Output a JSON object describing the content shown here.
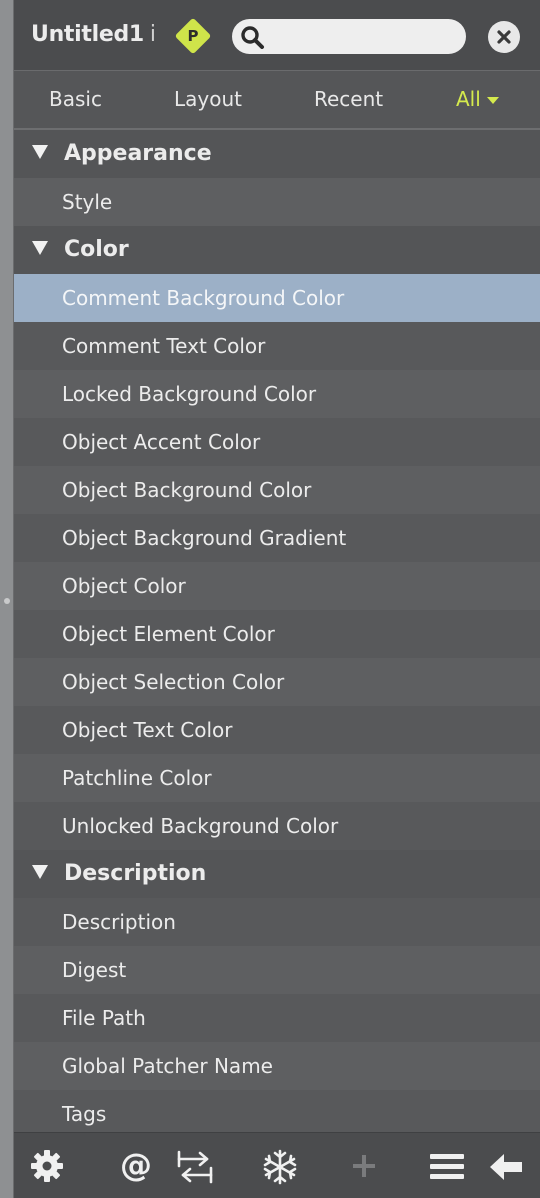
{
  "header": {
    "title": "Untitled1",
    "info_glyph": "i",
    "project_badge": "P",
    "search": {
      "value": "",
      "placeholder": ""
    }
  },
  "tabs": [
    {
      "label": "Basic"
    },
    {
      "label": "Layout"
    },
    {
      "label": "Recent"
    },
    {
      "label": "All",
      "active": true,
      "accent": "#d5ea4d"
    }
  ],
  "groups": [
    {
      "label": "Appearance",
      "items": [
        "Style"
      ]
    },
    {
      "label": "Color",
      "items": [
        "Comment Background Color",
        "Comment Text Color",
        "Locked Background Color",
        "Object Accent Color",
        "Object Background Color",
        "Object Background Gradient",
        "Object Color",
        "Object Element Color",
        "Object Selection Color",
        "Object Text Color",
        "Patchline Color",
        "Unlocked Background Color"
      ]
    },
    {
      "label": "Description",
      "items": [
        "Description",
        "Digest",
        "File Path",
        "Global Patcher Name",
        "Tags"
      ]
    }
  ],
  "selected_item": "Comment Background Color",
  "toolbar": {
    "icons": [
      "gear-icon",
      "at-icon",
      "swap-arrows-icon",
      "snowflake-icon",
      "plus-icon",
      "list-menu-icon",
      "back-arrow-icon"
    ],
    "at_glyph": "@"
  },
  "colors": {
    "selection": "#9cb0c7",
    "accent": "#d5ea4d",
    "badge": "#cfe44a"
  }
}
